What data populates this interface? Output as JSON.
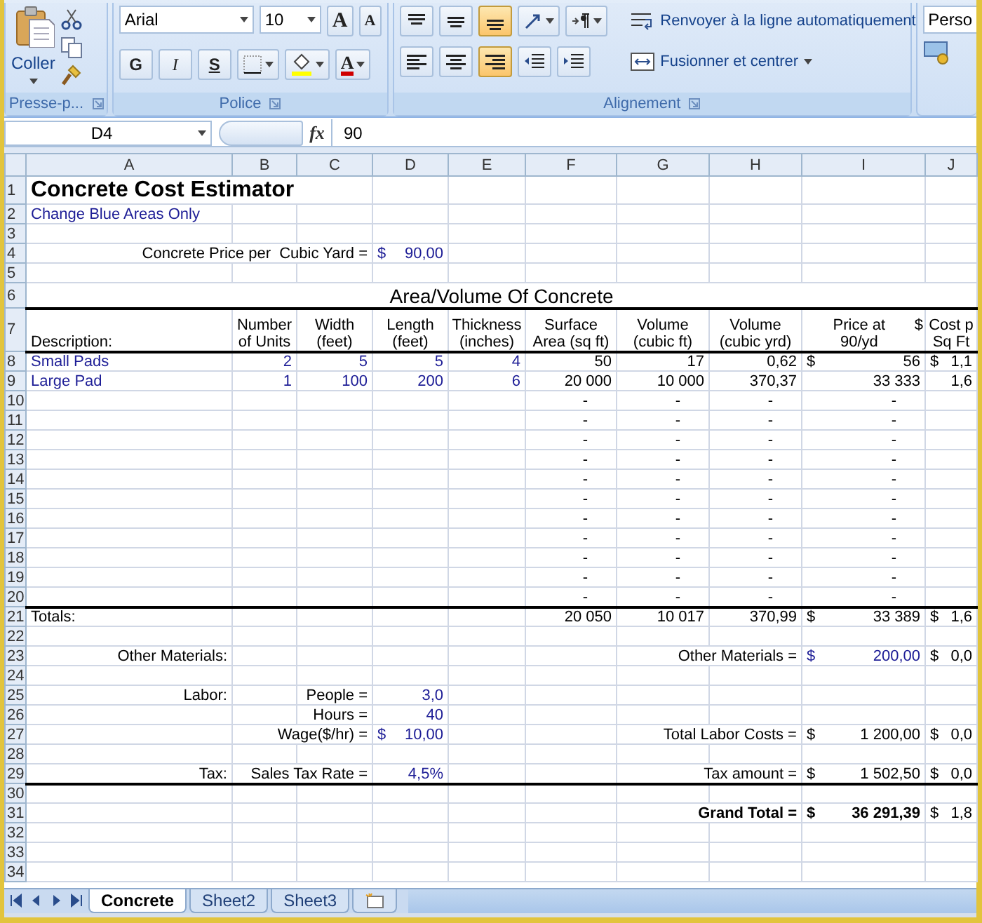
{
  "ribbon": {
    "clipboard": {
      "paste_label": "Coller",
      "group_label": "Presse-p..."
    },
    "font": {
      "family": "Arial",
      "size": "10",
      "grow": "A",
      "shrink": "A",
      "bold": "G",
      "italic": "I",
      "underline": "S",
      "font_color": "A",
      "group_label": "Police"
    },
    "alignment": {
      "top_row": [
        {
          "kind": "align-top",
          "selected": false
        },
        {
          "kind": "align-middle",
          "selected": false
        },
        {
          "kind": "align-bottom",
          "selected": true
        }
      ],
      "bottom_row": [
        {
          "kind": "align-left",
          "selected": false
        },
        {
          "kind": "align-center",
          "selected": false
        },
        {
          "kind": "align-right",
          "selected": true
        }
      ],
      "wrap_text": "Renvoyer à la ligne automatiquement",
      "merge": "Fusionner et centrer",
      "group_label": "Alignement"
    },
    "number": {
      "format": "Perso"
    }
  },
  "formula_bar": {
    "cell": "D4",
    "fx": "fx",
    "value": "90"
  },
  "columns": [
    "A",
    "B",
    "C",
    "D",
    "E",
    "F",
    "G",
    "H",
    "I",
    "J"
  ],
  "rows": [
    {
      "number": "1",
      "cells": [
        {
          "kind": "title",
          "text": "Concrete Cost Estimator"
        }
      ]
    },
    {
      "number": "2",
      "cells": [
        {
          "kind": "label",
          "text": "Change Blue Areas Only",
          "input": true
        }
      ]
    },
    {
      "number": "3"
    },
    {
      "number": "4",
      "cells": [
        null,
        null,
        {
          "kind": "caption",
          "text": "Concrete Price per  Cubic Yard ="
        },
        {
          "kind": "value",
          "currency": "$",
          "text": "90,00",
          "input": true
        }
      ]
    },
    {
      "number": "5"
    },
    {
      "number": "6",
      "rule_below": true,
      "cells": [
        {
          "kind": "banner",
          "text": "Area/Volume Of Concrete"
        }
      ]
    },
    {
      "number": "7",
      "rule_below": true,
      "cells": [
        {
          "kind": "label",
          "text": "Description:"
        },
        {
          "kind": "header",
          "lines": [
            "Number",
            "of Units"
          ]
        },
        {
          "kind": "header",
          "lines": [
            "Width",
            "(feet)"
          ]
        },
        {
          "kind": "header",
          "lines": [
            "Length",
            "(feet)"
          ]
        },
        {
          "kind": "header",
          "lines": [
            "Thickness",
            "(inches)"
          ]
        },
        {
          "kind": "header",
          "lines": [
            "Surface",
            "Area (sq ft)"
          ]
        },
        {
          "kind": "header",
          "lines": [
            "Volume",
            "(cubic ft)"
          ]
        },
        {
          "kind": "header",
          "lines": [
            "Volume",
            "(cubic yrd)"
          ]
        },
        {
          "kind": "header",
          "lines": [
            "Price at",
            "90/yd"
          ],
          "currency": "$"
        },
        {
          "kind": "header",
          "lines": [
            "Cost p",
            "Sq Ft"
          ]
        }
      ]
    },
    {
      "number": "8",
      "cells": [
        {
          "kind": "label",
          "text": "Small Pads",
          "input": true
        },
        {
          "kind": "value",
          "text": "2",
          "input": true
        },
        {
          "kind": "value",
          "text": "5",
          "input": true
        },
        {
          "kind": "value",
          "text": "5",
          "input": true
        },
        {
          "kind": "value",
          "text": "4",
          "input": true
        },
        {
          "kind": "value",
          "text": "50"
        },
        {
          "kind": "value",
          "text": "17"
        },
        {
          "kind": "value",
          "text": "0,62"
        },
        {
          "kind": "value",
          "currency": "$",
          "text": "56"
        },
        {
          "kind": "value",
          "currency": "$",
          "text": "1,1"
        }
      ]
    },
    {
      "number": "9",
      "cells": [
        {
          "kind": "label",
          "text": "Large Pad",
          "input": true
        },
        {
          "kind": "value",
          "text": "1",
          "input": true
        },
        {
          "kind": "value",
          "text": "100",
          "input": true
        },
        {
          "kind": "value",
          "text": "200",
          "input": true
        },
        {
          "kind": "value",
          "text": "6",
          "input": true
        },
        {
          "kind": "value",
          "text": "20 000"
        },
        {
          "kind": "value",
          "text": "10 000"
        },
        {
          "kind": "value",
          "text": "370,37"
        },
        {
          "kind": "value",
          "text": "33 333"
        },
        {
          "kind": "value",
          "text": "1,6"
        }
      ]
    },
    {
      "number": "10",
      "cells": [
        null,
        null,
        null,
        null,
        null,
        {
          "kind": "dash",
          "text": "-"
        },
        {
          "kind": "dash",
          "text": "-"
        },
        {
          "kind": "dash",
          "text": "-"
        },
        {
          "kind": "dash",
          "text": "-"
        }
      ]
    },
    {
      "number": "11",
      "cells": [
        null,
        null,
        null,
        null,
        null,
        {
          "kind": "dash",
          "text": "-"
        },
        {
          "kind": "dash",
          "text": "-"
        },
        {
          "kind": "dash",
          "text": "-"
        },
        {
          "kind": "dash",
          "text": "-"
        }
      ]
    },
    {
      "number": "12",
      "cells": [
        null,
        null,
        null,
        null,
        null,
        {
          "kind": "dash",
          "text": "-"
        },
        {
          "kind": "dash",
          "text": "-"
        },
        {
          "kind": "dash",
          "text": "-"
        },
        {
          "kind": "dash",
          "text": "-"
        }
      ]
    },
    {
      "number": "13",
      "cells": [
        null,
        null,
        null,
        null,
        null,
        {
          "kind": "dash",
          "text": "-"
        },
        {
          "kind": "dash",
          "text": "-"
        },
        {
          "kind": "dash",
          "text": "-"
        },
        {
          "kind": "dash",
          "text": "-"
        }
      ]
    },
    {
      "number": "14",
      "cells": [
        null,
        null,
        null,
        null,
        null,
        {
          "kind": "dash",
          "text": "-"
        },
        {
          "kind": "dash",
          "text": "-"
        },
        {
          "kind": "dash",
          "text": "-"
        },
        {
          "kind": "dash",
          "text": "-"
        }
      ]
    },
    {
      "number": "15",
      "cells": [
        null,
        null,
        null,
        null,
        null,
        {
          "kind": "dash",
          "text": "-"
        },
        {
          "kind": "dash",
          "text": "-"
        },
        {
          "kind": "dash",
          "text": "-"
        },
        {
          "kind": "dash",
          "text": "-"
        }
      ]
    },
    {
      "number": "16",
      "cells": [
        null,
        null,
        null,
        null,
        null,
        {
          "kind": "dash",
          "text": "-"
        },
        {
          "kind": "dash",
          "text": "-"
        },
        {
          "kind": "dash",
          "text": "-"
        },
        {
          "kind": "dash",
          "text": "-"
        }
      ]
    },
    {
      "number": "17",
      "cells": [
        null,
        null,
        null,
        null,
        null,
        {
          "kind": "dash",
          "text": "-"
        },
        {
          "kind": "dash",
          "text": "-"
        },
        {
          "kind": "dash",
          "text": "-"
        },
        {
          "kind": "dash",
          "text": "-"
        }
      ]
    },
    {
      "number": "18",
      "cells": [
        null,
        null,
        null,
        null,
        null,
        {
          "kind": "dash",
          "text": "-"
        },
        {
          "kind": "dash",
          "text": "-"
        },
        {
          "kind": "dash",
          "text": "-"
        },
        {
          "kind": "dash",
          "text": "-"
        }
      ]
    },
    {
      "number": "19",
      "cells": [
        null,
        null,
        null,
        null,
        null,
        {
          "kind": "dash",
          "text": "-"
        },
        {
          "kind": "dash",
          "text": "-"
        },
        {
          "kind": "dash",
          "text": "-"
        },
        {
          "kind": "dash",
          "text": "-"
        }
      ]
    },
    {
      "number": "20",
      "rule_below": true,
      "cells": [
        null,
        null,
        null,
        null,
        null,
        {
          "kind": "dash",
          "text": "-"
        },
        {
          "kind": "dash",
          "text": "-"
        },
        {
          "kind": "dash",
          "text": "-"
        },
        {
          "kind": "dash",
          "text": "-"
        }
      ]
    },
    {
      "number": "21",
      "cells": [
        {
          "kind": "label",
          "text": "Totals:"
        },
        null,
        null,
        null,
        null,
        {
          "kind": "value",
          "text": "20 050"
        },
        {
          "kind": "value",
          "text": "10 017"
        },
        {
          "kind": "value",
          "text": "370,99"
        },
        {
          "kind": "value",
          "currency": "$",
          "text": "33 389"
        },
        {
          "kind": "value",
          "currency": "$",
          "text": "1,6"
        }
      ]
    },
    {
      "number": "22"
    },
    {
      "number": "23",
      "cells": [
        {
          "kind": "caption",
          "text": "Other Materials:"
        },
        null,
        null,
        null,
        null,
        null,
        null,
        {
          "kind": "caption",
          "text": "Other Materials ="
        },
        {
          "kind": "value",
          "currency": "$",
          "text": "200,00",
          "input": true
        },
        {
          "kind": "value",
          "currency": "$",
          "text": "0,0"
        }
      ]
    },
    {
      "number": "24"
    },
    {
      "number": "25",
      "cells": [
        {
          "kind": "caption",
          "text": "Labor:"
        },
        null,
        {
          "kind": "caption",
          "text": "People ="
        },
        {
          "kind": "value",
          "text": "3,0",
          "input": true
        }
      ]
    },
    {
      "number": "26",
      "cells": [
        null,
        null,
        {
          "kind": "caption",
          "text": "Hours ="
        },
        {
          "kind": "value",
          "text": "40",
          "input": true
        }
      ]
    },
    {
      "number": "27",
      "cells": [
        null,
        null,
        {
          "kind": "caption",
          "text": "Wage($/hr) ="
        },
        {
          "kind": "value",
          "currency": "$",
          "text": "10,00",
          "input": true
        },
        null,
        null,
        null,
        {
          "kind": "caption",
          "text": "Total Labor Costs ="
        },
        {
          "kind": "value",
          "currency": "$",
          "text": "1 200,00"
        },
        {
          "kind": "value",
          "currency": "$",
          "text": "0,0"
        }
      ]
    },
    {
      "number": "28"
    },
    {
      "number": "29",
      "rule_below": true,
      "cells": [
        {
          "kind": "caption",
          "text": "Tax:"
        },
        null,
        {
          "kind": "caption",
          "text": "Sales Tax Rate ="
        },
        {
          "kind": "value",
          "text": "4,5%",
          "input": true
        },
        null,
        null,
        null,
        {
          "kind": "caption",
          "text": "Tax amount ="
        },
        {
          "kind": "value",
          "currency": "$",
          "text": "1 502,50"
        },
        {
          "kind": "value",
          "currency": "$",
          "text": "0,0"
        }
      ]
    },
    {
      "number": "30"
    },
    {
      "number": "31",
      "cells": [
        null,
        null,
        null,
        null,
        null,
        null,
        null,
        {
          "kind": "total",
          "text": "Grand Total ="
        },
        {
          "kind": "total",
          "currency": "$",
          "text": "36 291,39"
        },
        {
          "kind": "value",
          "currency": "$",
          "text": "1,8"
        }
      ]
    },
    {
      "number": "32"
    },
    {
      "number": "33"
    },
    {
      "number": "34"
    }
  ],
  "sheet_tabs": [
    {
      "label": "Concrete",
      "selected": true
    },
    {
      "label": "Sheet2",
      "selected": false
    },
    {
      "label": "Sheet3",
      "selected": false
    }
  ]
}
